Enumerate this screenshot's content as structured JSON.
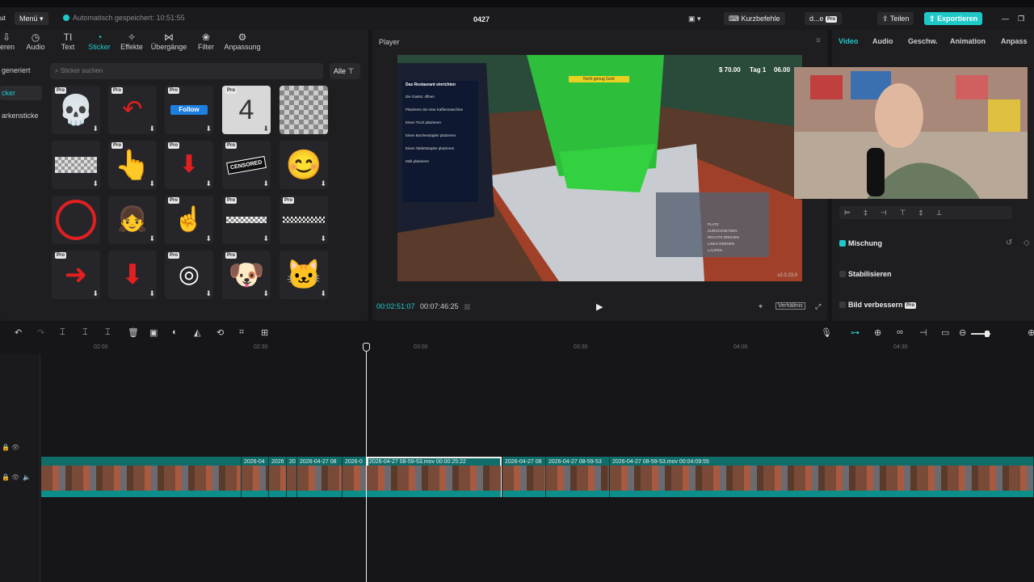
{
  "topbar": {
    "logo": "ut",
    "menu": "Menü",
    "save_status": "Automatisch gespeichert: 10:51:55",
    "project": "0427",
    "shortcuts": "Kurzbefehle",
    "user": "d...e",
    "share": "Teilen",
    "export": "Exportieren",
    "pro_badge": "Pro"
  },
  "left": {
    "categories": [
      "ieren",
      "Audio",
      "Text",
      "Sticker",
      "Effekte",
      "Übergänge",
      "Filter",
      "Anpassung"
    ],
    "side_items": [
      "generiert",
      "cker",
      "arkensticke"
    ],
    "search_placeholder": "Sticker suchen",
    "filter_label": "Alle",
    "stickers": [
      "skull",
      "red-arrow-curved",
      "follow-button",
      "countdown-4",
      "pixel-mosaic",
      "pixel-blur",
      "pointing-hand",
      "red-arrow-down",
      "censored",
      "face-emoji",
      "red-circle",
      "follow-girl",
      "finger-pointing",
      "pixel-bar",
      "pixel-glasses",
      "red-arrow-right",
      "red-arrow-down-2",
      "arrow-target",
      "surprised-dog",
      "crying-cat"
    ],
    "follow_text": "Follow",
    "censored_text": "CENSORED",
    "countdown_text": "4"
  },
  "player": {
    "title": "Player",
    "time_current": "00:02:51:07",
    "time_total": "00:07:46:25",
    "ratio": "Verhältnis",
    "game": {
      "money": "$ 70.00",
      "day": "Tag 1",
      "clock": "06.00",
      "warn": "Nicht genug Geld",
      "menu_title": "Das Restaurant einrichten",
      "tasks": [
        "Die Gastst. öffnen",
        "Platzieren Sie eine Kaffeemaschine",
        "Einen Tisch platzieren",
        "Einen Buchenstapler platzieren",
        "Einen Tablettstapler platzieren",
        "Müll platzieren"
      ],
      "controls": [
        "PLATZ",
        "ZURÜCKSETZEN",
        "RECHTS DREHEN",
        "LINKS DREHEN",
        "LAUFEN"
      ],
      "version": "v2.0.23.0"
    }
  },
  "right": {
    "tabs": [
      "Video",
      "Audio",
      "Geschw.",
      "Animation",
      "Anpass"
    ],
    "blend": "Mischung",
    "stabilize": "Stabilisieren",
    "enhance": "Bild verbessern"
  },
  "timeline": {
    "ticks": [
      "02:00",
      "02:30",
      "03:00",
      "03:30",
      "04:00",
      "04:30"
    ],
    "clips": [
      "2026-04",
      "2026",
      "20",
      "2026-04-27 08",
      "2026-0",
      "2026-04-27 08-59-53.mov  00:00:25:22",
      "2026-04-27 08",
      "2026-04-27 08-59-53",
      "2026-04-27 08-59-53.mov  00:04:09:55"
    ]
  },
  "colors": {
    "accent": "#1ec8c8",
    "clip": "#0f6d6a"
  }
}
